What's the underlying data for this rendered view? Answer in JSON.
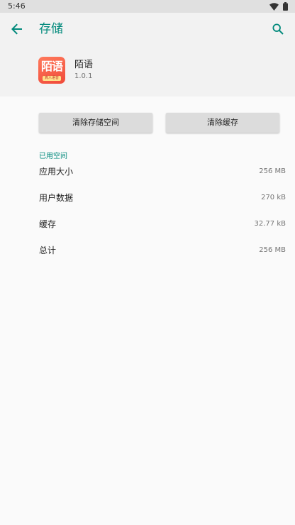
{
  "status_bar": {
    "time": "5:46",
    "icons": [
      "wifi-icon",
      "battery-icon"
    ]
  },
  "toolbar": {
    "title": "存储",
    "back_icon": "arrow-left-icon",
    "search_icon": "search-icon"
  },
  "app": {
    "icon_text": "陌语",
    "icon_subtext": "真人语音",
    "name": "陌语",
    "version": "1.0.1"
  },
  "actions": {
    "clear_storage_label": "清除存储空间",
    "clear_cache_label": "清除缓存"
  },
  "storage": {
    "section_title": "已用空间",
    "rows": [
      {
        "label": "应用大小",
        "value": "256 MB"
      },
      {
        "label": "用户数据",
        "value": "270 kB"
      },
      {
        "label": "缓存",
        "value": "32.77 kB"
      },
      {
        "label": "总计",
        "value": "256 MB"
      }
    ]
  },
  "colors": {
    "accent": "#00897b",
    "app_icon": "#f04a3a"
  }
}
